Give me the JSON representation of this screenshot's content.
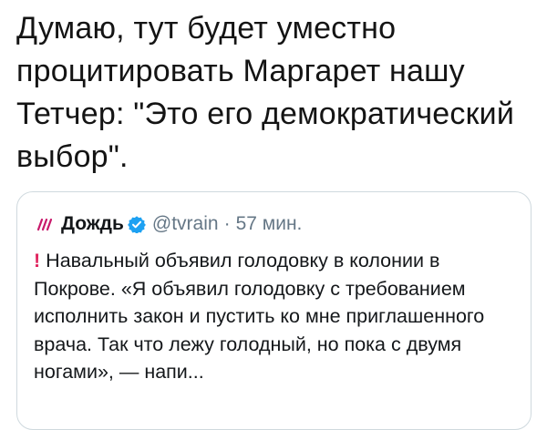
{
  "tweet": {
    "text": "Думаю, тут будет уместно процитировать Маргарет нашу Тетчер: \"Это его демократический выбор\"."
  },
  "quote": {
    "author_name": "Дождь",
    "handle": "@tvrain",
    "separator": "·",
    "time": "57 мин.",
    "warning_glyph": "!",
    "body": "Навальный объявил голодовку в колонии в Покрове. «Я объявил голодовку с требованием исполнить закон и пустить ко мне приглашенного врача. Так что лежу голодный, но пока с двумя ногами», — напи...",
    "icons": {
      "avatar": "tvrain-logo-icon",
      "verified": "verified-badge-icon",
      "warning": "exclamation-icon"
    },
    "colors": {
      "avatar": "#c8196b",
      "verified": "#1da1f2",
      "warning": "#e0245e",
      "secondary_text": "#657786",
      "border": "#cfd9de"
    }
  }
}
